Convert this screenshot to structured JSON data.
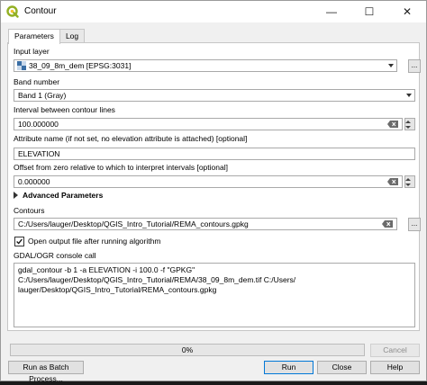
{
  "window": {
    "title": "Contour",
    "icon": "qgis-icon",
    "controls": {
      "minimize": "—",
      "maximize": "☐",
      "close": "✕"
    }
  },
  "tabs": [
    {
      "label": "Parameters",
      "active": true
    },
    {
      "label": "Log",
      "active": false
    }
  ],
  "params": {
    "input_layer": {
      "label": "Input layer",
      "value": "38_09_8m_dem [EPSG:3031]"
    },
    "band": {
      "label": "Band number",
      "value": "Band 1 (Gray)"
    },
    "interval": {
      "label": "Interval between contour lines",
      "value": "100.000000"
    },
    "attribute": {
      "label": "Attribute name (if not set, no elevation attribute is attached) [optional]",
      "value": "ELEVATION"
    },
    "offset": {
      "label": "Offset from zero relative to which to interpret intervals [optional]",
      "value": "0.000000"
    },
    "advanced": {
      "label": "Advanced Parameters"
    },
    "contours": {
      "label": "Contours",
      "value": "C:/Users/lauger/Desktop/QGIS_Intro_Tutorial/REMA_contours.gpkg"
    },
    "open_output": {
      "label": "Open output file after running algorithm",
      "checked": true
    },
    "console": {
      "label": "GDAL/OGR console call",
      "value": "gdal_contour -b 1 -a ELEVATION -i 100.0 -f \"GPKG\" C:/Users/lauger/Desktop/QGIS_Intro_Tutorial/REMA/38_09_8m_dem.tif C:/Users/\nlauger/Desktop/QGIS_Intro_Tutorial/REMA_contours.gpkg"
    },
    "browse_label": "..."
  },
  "progress": {
    "text": "0%",
    "percent": 0
  },
  "buttons": {
    "cancel": "Cancel",
    "batch": "Run as Batch Process...",
    "run": "Run",
    "close": "Close",
    "help": "Help"
  },
  "colors": {
    "accent": "#0078d7",
    "qgis_green": "#93b023"
  }
}
